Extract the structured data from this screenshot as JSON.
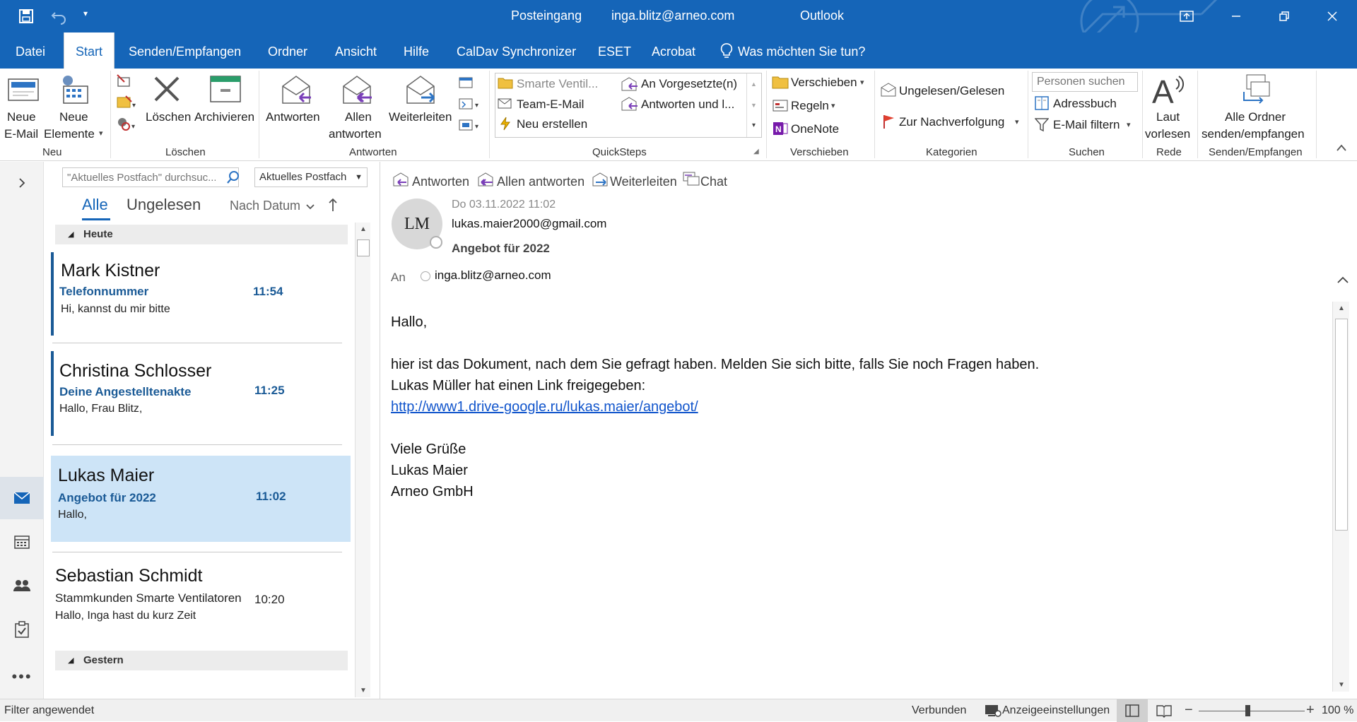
{
  "titlebar": {
    "folder": "Posteingang",
    "account": "inga.blitz@arneo.com",
    "app": "Outlook"
  },
  "menu": {
    "tabs": [
      "Datei",
      "Start",
      "Senden/Empfangen",
      "Ordner",
      "Ansicht",
      "Hilfe",
      "CalDav Synchronizer",
      "ESET",
      "Acrobat"
    ],
    "tell_me": "Was möchten Sie tun?"
  },
  "ribbon": {
    "neu": {
      "new_mail_1": "Neue",
      "new_mail_2": "E-Mail",
      "new_items_1": "Neue",
      "new_items_2": "Elemente",
      "group": "Neu"
    },
    "loeschen": {
      "delete": "Löschen",
      "archive": "Archivieren",
      "group": "Löschen"
    },
    "antworten": {
      "reply": "Antworten",
      "reply_all_1": "Allen",
      "reply_all_2": "antworten",
      "forward": "Weiterleiten",
      "group": "Antworten"
    },
    "quicksteps": {
      "items": [
        "Smarte Ventil...",
        "Team-E-Mail",
        "Neu erstellen",
        "An Vorgesetzte(n)",
        "Antworten und l..."
      ],
      "group": "QuickSteps"
    },
    "verschieben": {
      "move": "Verschieben",
      "rules": "Regeln",
      "onenote": "OneNote",
      "group": "Verschieben"
    },
    "kategorien": {
      "unread": "Ungelesen/Gelesen",
      "followup": "Zur Nachverfolgung",
      "group": "Kategorien"
    },
    "suchen": {
      "people_placeholder": "Personen suchen",
      "address_book": "Adressbuch",
      "filter": "E-Mail filtern",
      "group": "Suchen"
    },
    "rede": {
      "read_1": "Laut",
      "read_2": "vorlesen",
      "group": "Rede"
    },
    "senden": {
      "sendall_1": "Alle Ordner",
      "sendall_2": "senden/empfangen",
      "group": "Senden/Empfangen"
    }
  },
  "search": {
    "placeholder": "\"Aktuelles Postfach\" durchsuc...",
    "scope": "Aktuelles Postfach"
  },
  "filters": {
    "all": "Alle",
    "unread": "Ungelesen",
    "sort": "Nach Datum"
  },
  "groups": {
    "today": "Heute",
    "yesterday": "Gestern"
  },
  "emails": [
    {
      "sender": "Mark Kistner",
      "subject": "Telefonnummer",
      "time": "11:54",
      "preview": "Hi, kannst du mir bitte"
    },
    {
      "sender": "Christina Schlosser",
      "subject": "Deine Angestelltenakte",
      "time": "11:25",
      "preview": "Hallo,  Frau Blitz,"
    },
    {
      "sender": "Lukas Maier",
      "subject": "Angebot für 2022",
      "time": "11:02",
      "preview": "Hallo,"
    },
    {
      "sender": "Sebastian Schmidt",
      "subject": "Stammkunden Smarte Ventilatoren",
      "time": "10:20",
      "preview": "Hallo, Inga hast du kurz Zeit"
    }
  ],
  "reading": {
    "actions": {
      "reply": "Antworten",
      "reply_all": "Allen antworten",
      "forward": "Weiterleiten",
      "chat": "Chat"
    },
    "initials": "LM",
    "date": "Do 03.11.2022 11:02",
    "from": "lukas.maier2000@gmail.com",
    "subject": "Angebot für 2022",
    "to_label": "An",
    "to": "inga.blitz@arneo.com",
    "greeting": "Hallo,",
    "line1": "hier ist das Dokument, nach dem Sie gefragt haben. Melden Sie sich bitte, falls Sie noch Fragen haben.",
    "line2": "Lukas Müller hat einen Link freigegeben:",
    "link": "http://www1.drive-google.ru/lukas.maier/angebot/",
    "closing": "Viele Grüße",
    "sig_name": "Lukas Maier",
    "sig_company": "Arneo GmbH"
  },
  "status": {
    "filter": "Filter angewendet",
    "connected": "Verbunden",
    "display": "Anzeigeeinstellungen",
    "zoom": "100 %"
  },
  "colors": {
    "brand": "#1565b8",
    "selected": "#cde4f7",
    "unread_accent": "#1a5a96"
  }
}
